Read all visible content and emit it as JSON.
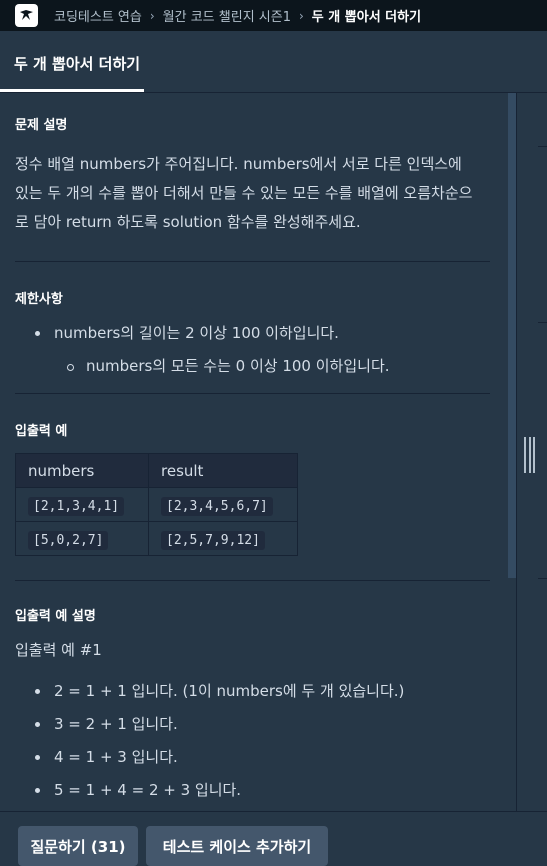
{
  "breadcrumb": {
    "items": [
      "코딩테스트 연습",
      "월간 코드 챌린지 시즌1",
      "두 개 뽑아서 더하기"
    ]
  },
  "tab": {
    "label": "두 개 뽑아서 더하기"
  },
  "problem": {
    "title": "문제 설명",
    "lines": [
      "정수 배열 numbers가 주어집니다. numbers에서 서로 다른 인덱스에",
      "있는 두 개의 수를 뽑아 더해서 만들 수 있는 모든 수를 배열에 오름차순으",
      "로 담아 return 하도록 solution 함수를 완성해주세요."
    ]
  },
  "constraints": {
    "title": "제한사항",
    "items": [
      "numbers의 길이는 2 이상 100 이하입니다.",
      "numbers의 모든 수는 0 이상 100 이하입니다."
    ]
  },
  "io_example": {
    "title": "입출력 예",
    "headers": [
      "numbers",
      "result"
    ],
    "rows": [
      [
        "[2,1,3,4,1]",
        "[2,3,4,5,6,7]"
      ],
      [
        "[5,0,2,7]",
        "[2,5,7,9,12]"
      ]
    ]
  },
  "io_explanation": {
    "title": "입출력 예 설명",
    "subtitle": "입출력 예 #1",
    "items": [
      "2 = 1 + 1 입니다. (1이 numbers에 두 개 있습니다.)",
      "3 = 2 + 1 입니다.",
      "4 = 1 + 3 입니다.",
      "5 = 1 + 4 = 2 + 3 입니다."
    ]
  },
  "buttons": {
    "question": "질문하기 (31)",
    "add_testcase": "테스트 케이스 추가하기"
  },
  "icons": {
    "logo": "programmers-logo-icon",
    "chevron": "chevron-right-icon"
  }
}
